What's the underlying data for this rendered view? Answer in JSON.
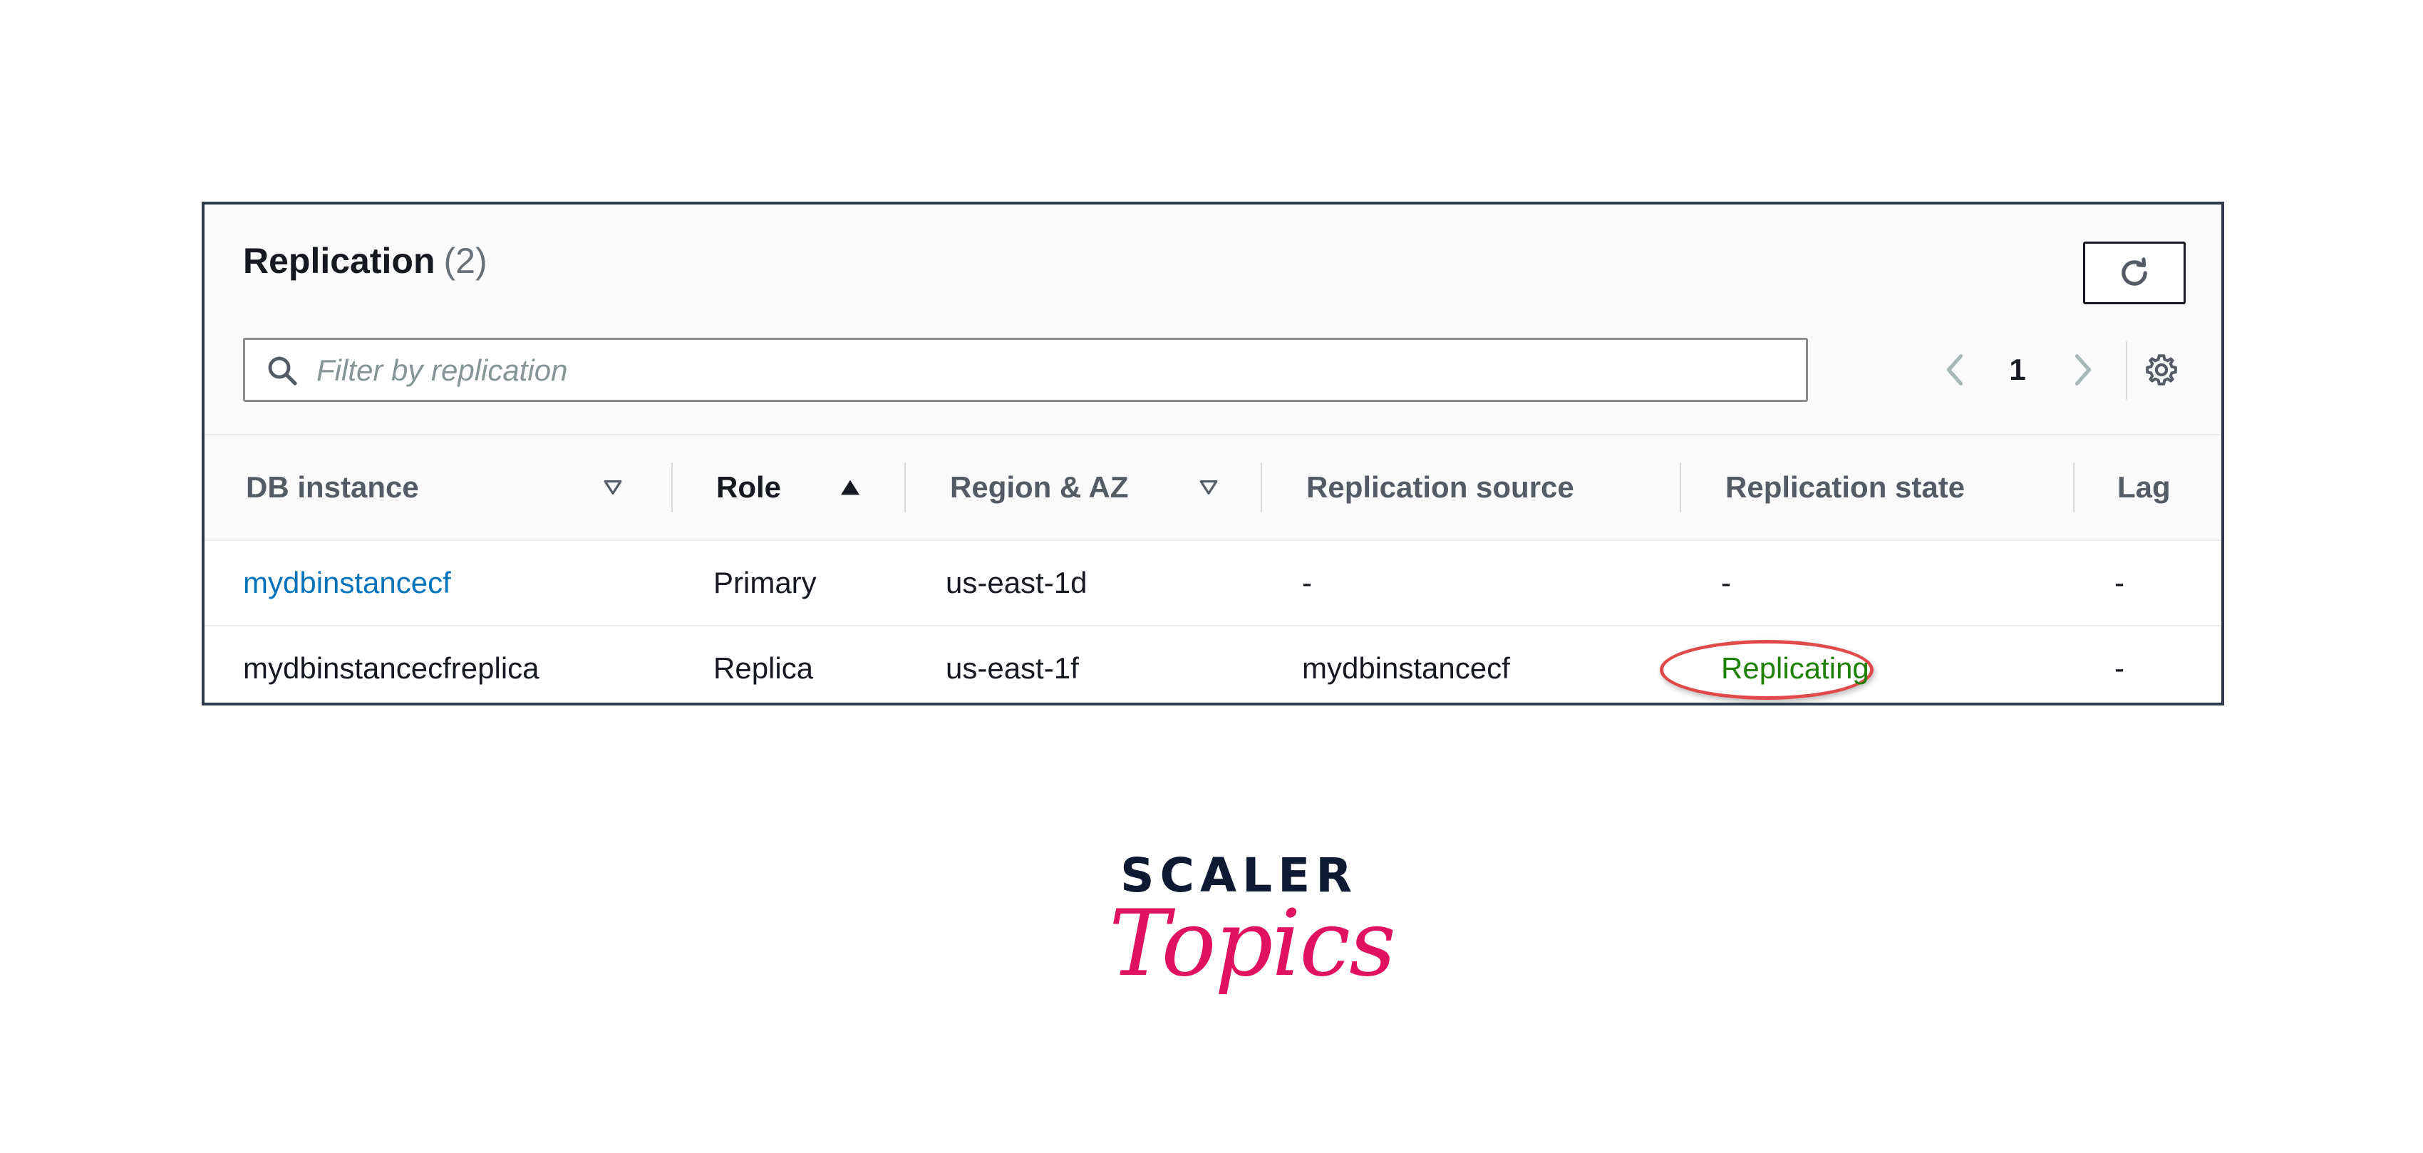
{
  "panel": {
    "title": "Replication",
    "count": "(2)",
    "refresh_icon": "refresh-icon"
  },
  "search": {
    "placeholder": "Filter by replication",
    "value": "",
    "icon": "search-icon"
  },
  "pagination": {
    "current_page": "1",
    "prev_icon": "chevron-left-icon",
    "next_icon": "chevron-right-icon",
    "settings_icon": "gear-icon"
  },
  "table": {
    "columns": [
      {
        "label": "DB instance",
        "sort": "unsorted"
      },
      {
        "label": "Role",
        "sort": "ascending"
      },
      {
        "label": "Region & AZ",
        "sort": "unsorted"
      },
      {
        "label": "Replication source"
      },
      {
        "label": "Replication state"
      },
      {
        "label": "Lag"
      }
    ],
    "rows": [
      {
        "db_instance": "mydbinstancecf",
        "role": "Primary",
        "region_az": "us-east-1d",
        "replication_source": "-",
        "replication_state": "-",
        "lag": "-"
      },
      {
        "db_instance": "mydbinstancecfreplica",
        "role": "Replica",
        "region_az": "us-east-1f",
        "replication_source": "mydbinstancecf",
        "replication_state": "Replicating",
        "lag": "-"
      }
    ]
  },
  "colors": {
    "link": "#0073bb",
    "status_ok": "#1d8102",
    "highlight": "#e04a4a",
    "logo_dark": "#0e1a33",
    "logo_pink": "#e0115f"
  },
  "logo": {
    "top": "SCALER",
    "bottom": "Topics"
  }
}
